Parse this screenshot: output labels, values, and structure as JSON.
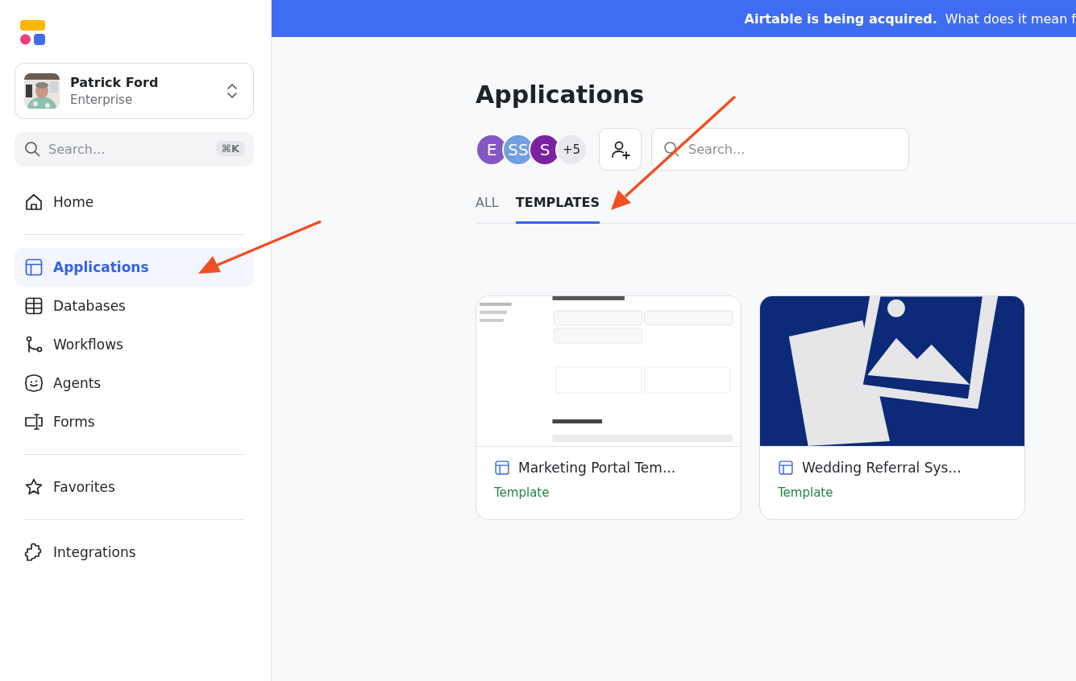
{
  "sidebar": {
    "user": {
      "name": "Patrick Ford",
      "plan": "Enterprise"
    },
    "search": {
      "placeholder": "Search...",
      "shortcut": "⌘K"
    },
    "nav_groups": [
      [
        {
          "label": "Home",
          "kind": "home",
          "selected": false
        }
      ],
      [
        {
          "label": "Applications",
          "kind": "layout",
          "selected": true
        },
        {
          "label": "Databases",
          "kind": "grid",
          "selected": false
        },
        {
          "label": "Workflows",
          "kind": "flow",
          "selected": false
        },
        {
          "label": "Agents",
          "kind": "agent",
          "selected": false
        },
        {
          "label": "Forms",
          "kind": "form",
          "selected": false
        }
      ],
      [
        {
          "label": "Favorites",
          "kind": "star",
          "selected": false
        }
      ],
      [
        {
          "label": "Integrations",
          "kind": "puzzle",
          "selected": false
        }
      ]
    ]
  },
  "banner": {
    "texts": [
      "Airtable is being acquired.",
      "What does it mean f"
    ]
  },
  "page": {
    "title": "Applications",
    "members": [
      {
        "initials": "E",
        "color": "#8456c6"
      },
      {
        "initials": "SS",
        "color": "#72a0e0"
      },
      {
        "initials": "S",
        "color": "#7b22a3"
      }
    ],
    "more_members": "+5",
    "search": {
      "placeholder": "Search..."
    },
    "tabs": [
      {
        "label": "ALL",
        "selected": false
      },
      {
        "label": "TEMPLATES",
        "selected": true
      }
    ],
    "cards": [
      {
        "title": "Marketing Portal Tem...",
        "tag": "Template",
        "kind": "screenshot"
      },
      {
        "title": "Wedding Referral Sys...",
        "tag": "Template",
        "kind": "placeholder"
      }
    ]
  }
}
